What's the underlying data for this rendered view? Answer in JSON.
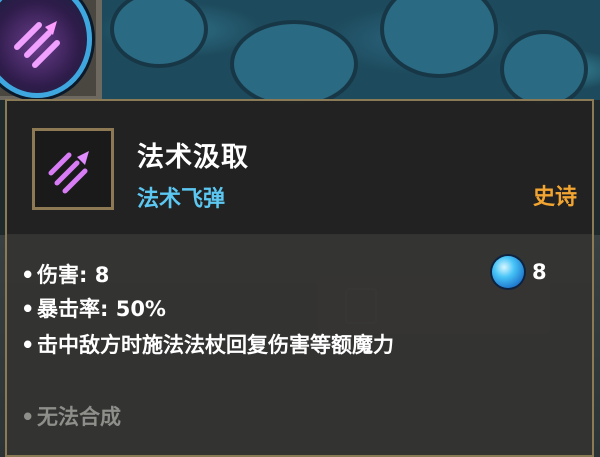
{
  "weapon": {
    "name": "法术汲取",
    "type": "法术飞弹",
    "rarity": "史诗",
    "icon": "arcane-missile-icon"
  },
  "stats": [
    {
      "text": "伤害: 8"
    },
    {
      "text": "暴击率: 50%"
    },
    {
      "text": "击中敌方时施法法杖回复伤害等额魔力"
    },
    {
      "text": "无法合成"
    }
  ],
  "energy_cost": "8",
  "colors": {
    "name": "#ffffff",
    "type": "#5cc8f2",
    "rarity": "#f3a531",
    "disabled": "#8e8e8a",
    "frame": "#8a7a55"
  }
}
